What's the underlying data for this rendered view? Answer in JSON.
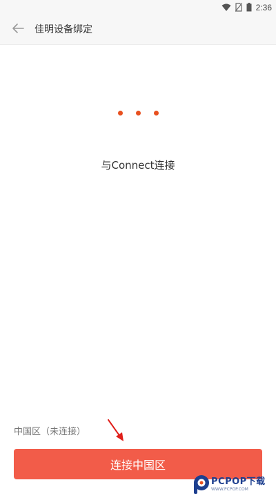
{
  "status_bar": {
    "time": "2:36",
    "icons": [
      "wifi-icon",
      "no-sim-icon",
      "battery-icon"
    ]
  },
  "header": {
    "title": "佳明设备绑定",
    "back_icon": "back-arrow-icon"
  },
  "main": {
    "connect_message": "与Connect连接",
    "loading_dot_color": "#e8501f"
  },
  "footer": {
    "region_status": "中国区（未连接）",
    "connect_button_label": "连接中国区",
    "button_color": "#f25c49",
    "annotation_arrow_color": "#e0201b"
  },
  "watermark": {
    "main": "PCPOP下载",
    "sub": "WWW.PCPOP.COM"
  }
}
